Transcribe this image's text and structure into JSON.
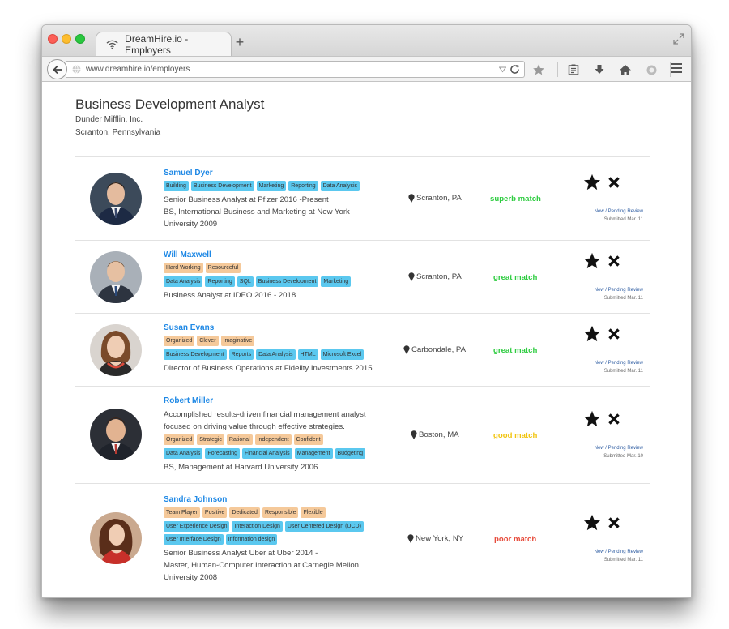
{
  "browser": {
    "tab_title": "DreamHire.io - Employers",
    "new_tab_label": "+",
    "url": "www.dreamhire.io/employers"
  },
  "job": {
    "title": "Business Development Analyst",
    "company": "Dunder Mifflin, Inc.",
    "location": "Scranton, Pennsylvania"
  },
  "colors": {
    "tag_skill": "#5bc8ef",
    "tag_trait": "#f5c99a",
    "name_link": "#1e88e5",
    "superb": "#2ecc40",
    "great": "#2ecc40",
    "good": "#f1c40f",
    "poor": "#e74c3c"
  },
  "candidates": [
    {
      "name": "Samuel Dyer",
      "trait_tags": [],
      "skill_tags": [
        "Building",
        "Business Development",
        "Marketing",
        "Reporting",
        "Data Analysis"
      ],
      "lines": [
        "Senior Business Analyst at Pfizer 2016 -Present",
        "BS, International Business and Marketing at New York",
        "University 2009"
      ],
      "location": "Scranton, PA",
      "match": "superb match",
      "status": "New / Pending Review",
      "submitted": "Submitted Mar. 11"
    },
    {
      "name": "Will Maxwell",
      "trait_tags": [
        "Hard Working",
        "Resourceful"
      ],
      "skill_tags": [
        "Data Analysis",
        "Reporting",
        "SQL",
        "Business Development",
        "Marketing"
      ],
      "lines": [
        "Business Analyst at IDEO 2016 - 2018"
      ],
      "location": "Scranton, PA",
      "match": "great match",
      "status": "New / Pending Review",
      "submitted": "Submitted Mar. 11"
    },
    {
      "name": "Susan Evans",
      "trait_tags": [
        "Organized",
        "Clever",
        "Imaginative"
      ],
      "skill_tags": [
        "Business Development",
        "Reports",
        "Data Analysis",
        "HTML",
        "Microsoft Excel"
      ],
      "lines": [
        "Director of Business Operations at Fidelity Investments 2015"
      ],
      "location": "Carbondale, PA",
      "match": "great match",
      "status": "New / Pending Review",
      "submitted": "Submitted Mar. 11"
    },
    {
      "name": "Robert Miller",
      "summary": [
        "Accomplished results-driven financial management analyst",
        "focused on driving value through effective strategies."
      ],
      "trait_tags": [
        "Organized",
        "Strategic",
        "Rational",
        "Independent",
        "Confident"
      ],
      "skill_tags": [
        "Data Analysis",
        "Forecasting",
        "Financial Analysis",
        "Management",
        "Budgeting"
      ],
      "lines": [
        "BS, Management at Harvard University 2006"
      ],
      "location": "Boston, MA",
      "match": "good match",
      "status": "New / Pending Review",
      "submitted": "Submitted Mar. 10"
    },
    {
      "name": "Sandra Johnson",
      "trait_tags": [
        "Team Player",
        "Positive",
        "Dedicated",
        "Responsible",
        "Flexible"
      ],
      "skill_tags": [
        "User Experience Design",
        "Interaction Design",
        "User Centered Design (UCD)",
        "User Interface Design",
        "Information design"
      ],
      "lines": [
        "Senior Business Analyst Uber at Uber 2014 -",
        "Master, Human-Computer Interaction at Carnegie Mellon",
        "University 2008"
      ],
      "location": "New York, NY",
      "match": "poor match",
      "status": "New / Pending Review",
      "submitted": "Submitted Mar. 11"
    }
  ]
}
